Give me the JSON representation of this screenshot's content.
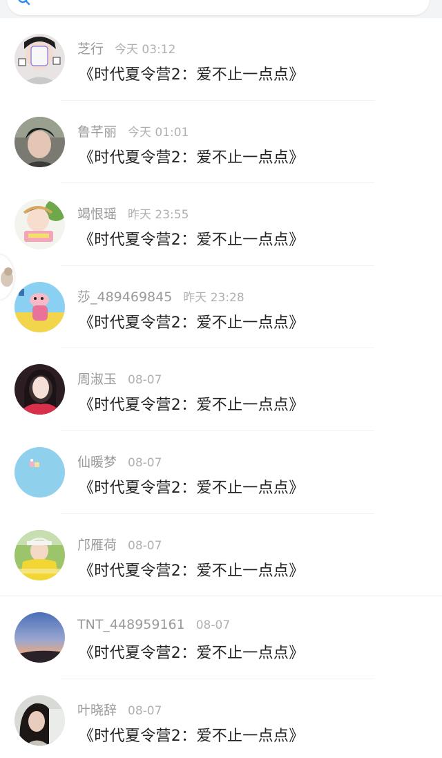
{
  "messages": [
    {
      "name": "芝行",
      "time": "今天 03:12",
      "text": "《时代夏令营2：爱不止一点点》"
    },
    {
      "name": "鲁芊丽",
      "time": "今天 01:01",
      "text": "《时代夏令营2：爱不止一点点》"
    },
    {
      "name": "竭恨瑶",
      "time": "昨天 23:55",
      "text": "《时代夏令营2：爱不止一点点》"
    },
    {
      "name": "莎_489469845",
      "time": "昨天 23:28",
      "text": "《时代夏令营2：爱不止一点点》"
    },
    {
      "name": "周淑玉",
      "time": "08-07",
      "text": "《时代夏令营2：爱不止一点点》"
    },
    {
      "name": "仙暖梦",
      "time": "08-07",
      "text": "《时代夏令营2：爱不止一点点》"
    },
    {
      "name": "邝雁荷",
      "time": "08-07",
      "text": "《时代夏令营2：爱不止一点点》"
    },
    {
      "name": "TNT_448959161",
      "time": "08-07",
      "text": "《时代夏令营2：爱不止一点点》"
    },
    {
      "name": "叶晓辞",
      "time": "08-07",
      "text": "《时代夏令营2：爱不止一点点》"
    }
  ],
  "icons": {
    "search": "search-icon",
    "floating": "floating-bubble-icon"
  },
  "colors": {
    "name_text": "#9a9a9a",
    "time_text": "#b0b0b0",
    "message_text": "#222222",
    "accent": "#2f8cf0"
  }
}
